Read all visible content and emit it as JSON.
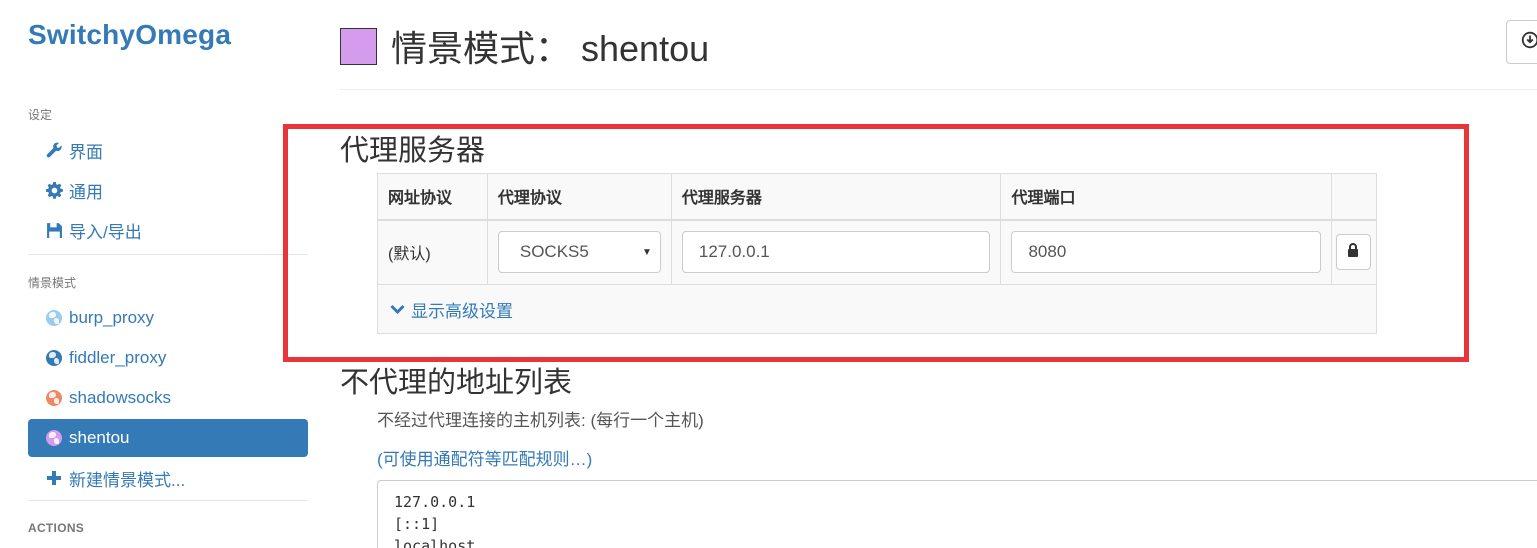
{
  "sidebar": {
    "brand": "SwitchyOmega",
    "settings_header": "设定",
    "settings_items": [
      {
        "label": "界面",
        "icon": "wrench-icon"
      },
      {
        "label": "通用",
        "icon": "gear-icon"
      },
      {
        "label": "导入/导出",
        "icon": "floppy-icon"
      }
    ],
    "profiles_header": "情景模式",
    "profiles": [
      {
        "label": "burp_proxy",
        "color": "#99ccee"
      },
      {
        "label": "fiddler_proxy",
        "color": "#337ab7"
      },
      {
        "label": "shadowsocks",
        "color": "#ee8866"
      },
      {
        "label": "shentou",
        "color": "#d59bec",
        "active": true
      }
    ],
    "new_profile": "新建情景模式...",
    "actions_header": "ACTIONS"
  },
  "header": {
    "title": "情景模式：  shentou",
    "profile_color": "#d59bec"
  },
  "proxy_section": {
    "title": "代理服务器",
    "columns": [
      "网址协议",
      "代理协议",
      "代理服务器",
      "代理端口",
      ""
    ],
    "row": {
      "scheme": "(默认)",
      "protocol": "SOCKS5",
      "server": "127.0.0.1",
      "port": "8080"
    },
    "advanced_link": "显示高级设置"
  },
  "bypass_section": {
    "title": "不代理的地址列表",
    "help": "不经过代理连接的主机列表: (每行一个主机)",
    "rules_link": "(可使用通配符等匹配规则…)",
    "list_text": "127.0.0.1\n[::1]\nlocalhost"
  },
  "colors": {
    "accent": "#337ab7",
    "highlight_box": "#e8353a"
  }
}
